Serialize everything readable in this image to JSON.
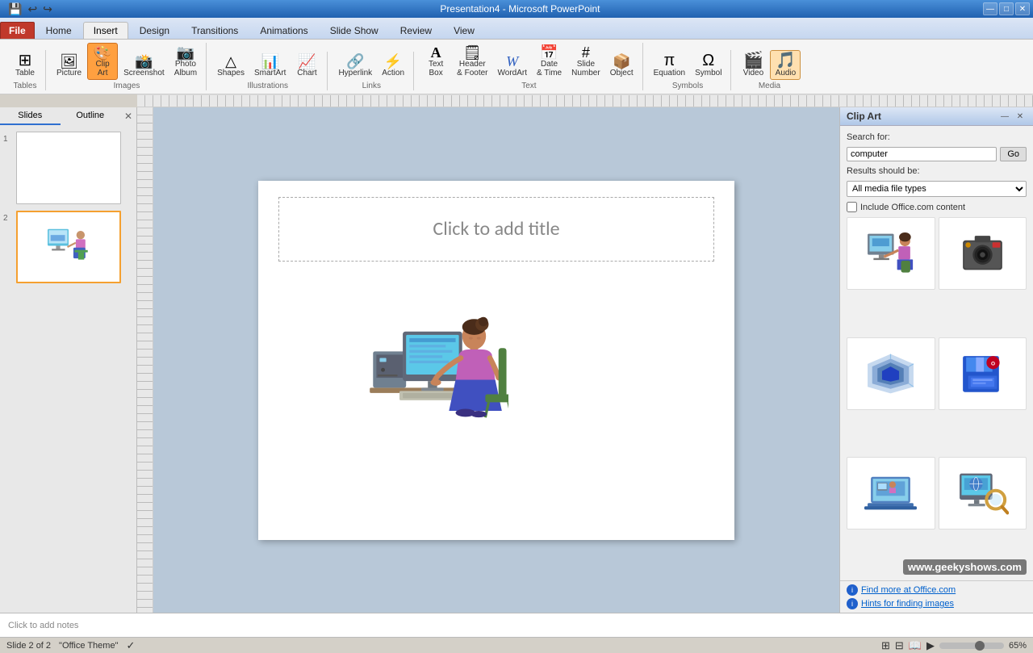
{
  "titlebar": {
    "title": "Presentation4 - Microsoft PowerPoint",
    "controls": [
      "—",
      "□",
      "✕"
    ]
  },
  "quickaccess": {
    "buttons": [
      "💾",
      "↩",
      "↪"
    ]
  },
  "ribbon": {
    "tabs": [
      "File",
      "Home",
      "Insert",
      "Design",
      "Transitions",
      "Animations",
      "Slide Show",
      "Review",
      "View"
    ],
    "active_tab": "Insert",
    "groups": [
      {
        "name": "Tables",
        "buttons": [
          {
            "label": "Table",
            "icon": "⊞"
          }
        ]
      },
      {
        "name": "Images",
        "buttons": [
          {
            "label": "Picture",
            "icon": "🖼"
          },
          {
            "label": "Clip Art",
            "icon": "🎨",
            "active": true
          },
          {
            "label": "Screenshot",
            "icon": "📸"
          },
          {
            "label": "Photo Album",
            "icon": "📷"
          }
        ]
      },
      {
        "name": "Illustrations",
        "buttons": [
          {
            "label": "Shapes",
            "icon": "△"
          },
          {
            "label": "SmartArt",
            "icon": "📊"
          },
          {
            "label": "Chart",
            "icon": "📈"
          }
        ]
      },
      {
        "name": "Links",
        "buttons": [
          {
            "label": "Hyperlink",
            "icon": "🔗"
          },
          {
            "label": "Action",
            "icon": "⚡"
          }
        ]
      },
      {
        "name": "Text",
        "buttons": [
          {
            "label": "Text Box",
            "icon": "A"
          },
          {
            "label": "Header & Footer",
            "icon": "🗒"
          },
          {
            "label": "WordArt",
            "icon": "W"
          },
          {
            "label": "Date & Time",
            "icon": "📅"
          },
          {
            "label": "Slide Number",
            "icon": "#"
          },
          {
            "label": "Object",
            "icon": "📦"
          }
        ]
      },
      {
        "name": "Symbols",
        "buttons": [
          {
            "label": "Equation",
            "icon": "π"
          },
          {
            "label": "Symbol",
            "icon": "Ω"
          }
        ]
      },
      {
        "name": "Media",
        "buttons": [
          {
            "label": "Video",
            "icon": "🎬"
          },
          {
            "label": "Audio",
            "icon": "🎵",
            "active": true
          }
        ]
      }
    ]
  },
  "slides_panel": {
    "tabs": [
      "Slides",
      "Outline"
    ],
    "slides": [
      {
        "number": 1,
        "has_content": false
      },
      {
        "number": 2,
        "has_content": true
      }
    ],
    "current_slide": 2
  },
  "slide": {
    "title_placeholder": "Click to add title",
    "notes_placeholder": "Click to add notes"
  },
  "clip_art": {
    "panel_title": "Clip Art",
    "search_label": "Search for:",
    "search_value": "computer",
    "go_button": "Go",
    "results_label": "Results should be:",
    "media_type": "All media file types",
    "include_office_label": "Include Office.com content",
    "footer_links": [
      "Find more at Office.com",
      "Hints for finding images"
    ]
  },
  "statusbar": {
    "slide_info": "Slide 2 of 2",
    "theme": "\"Office Theme\"",
    "zoom": "65%"
  }
}
